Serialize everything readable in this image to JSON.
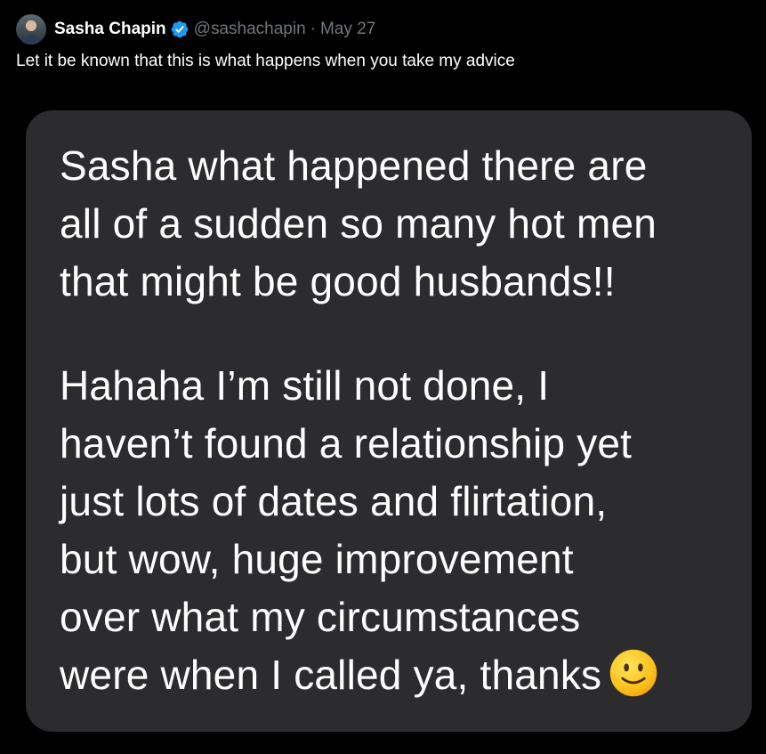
{
  "tweet": {
    "author_name": "Sasha Chapin",
    "handle": "@sashachapin",
    "separator": "·",
    "date": "May 27",
    "text": "Let it be known that this is what happens when you take my advice"
  },
  "image_message": {
    "lines_1": [
      "Sasha what happened there are",
      "all of a sudden so many hot men",
      "that might be good husbands!!"
    ],
    "lines_2": [
      "Hahaha I’m still not done, I",
      "haven’t found a relationship yet",
      "just lots of dates and flirtation,",
      "but wow, huge improvement",
      "over what my circumstances",
      "were when I called ya, thanks"
    ],
    "emoji": "slightly-smiling-face-icon"
  },
  "colors": {
    "background": "#000000",
    "bubble": "#2c2c2e",
    "verified": "#1d9bf0",
    "muted": "#71767b"
  }
}
